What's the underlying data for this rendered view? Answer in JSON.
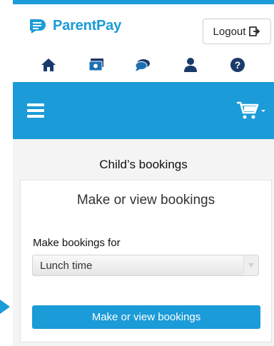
{
  "header": {
    "brand": "ParentPay",
    "logout_label": "Logout",
    "colors": {
      "accent": "#1b9bd7",
      "navy": "#1a3a6b"
    }
  },
  "nav_icons": [
    "home-icon",
    "payments-icon",
    "messages-icon",
    "profile-icon",
    "help-icon"
  ],
  "page": {
    "title": "Child’s bookings"
  },
  "card": {
    "title": "Make or view bookings",
    "field_label": "Make bookings for",
    "select_value": "Lunch time",
    "button_label": "Make or view bookings"
  }
}
